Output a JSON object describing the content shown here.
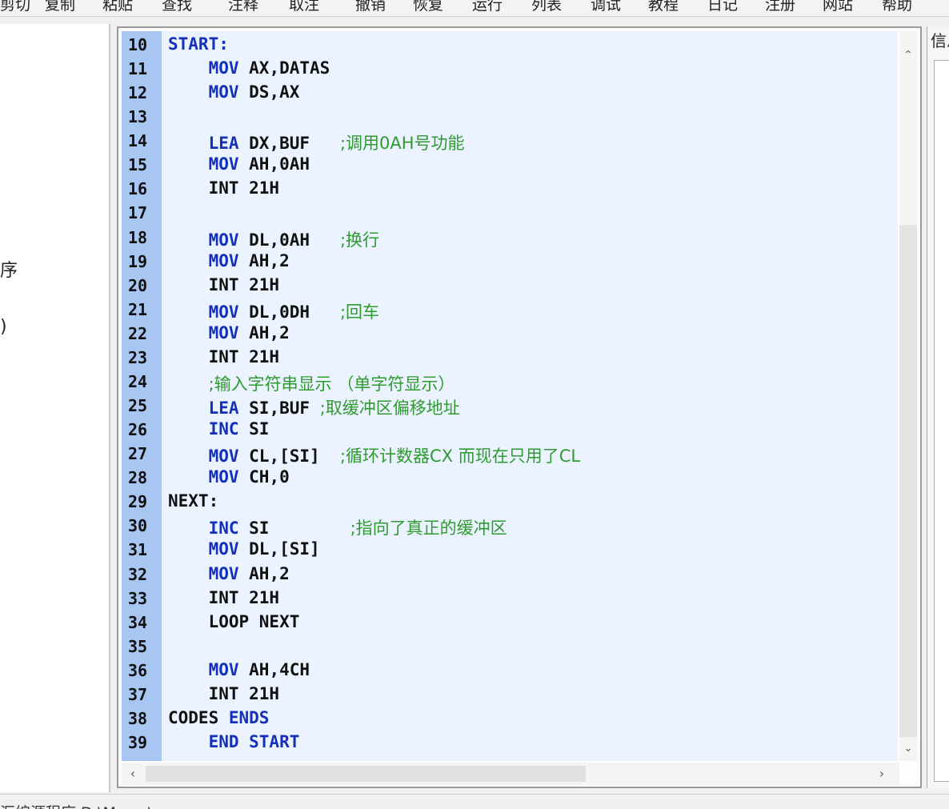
{
  "toolbar": {
    "items": [
      "剪切",
      "复制",
      "粘贴",
      "查找",
      "注释",
      "取注",
      "撤销",
      "恢复",
      "运行",
      "列表",
      "调试",
      "教程",
      "日记",
      "注册",
      "网站",
      "帮助"
    ]
  },
  "left_panel": {
    "frag1": "序",
    "frag2": ")"
  },
  "right_panel": {
    "title": "信息"
  },
  "editor": {
    "lines": [
      {
        "n": "10",
        "segs": [
          {
            "t": "START:",
            "c": "kw"
          }
        ]
      },
      {
        "n": "11",
        "segs": [
          {
            "t": "    "
          },
          {
            "t": "MOV",
            "c": "kw"
          },
          {
            "t": " AX,DATAS"
          }
        ]
      },
      {
        "n": "12",
        "segs": [
          {
            "t": "    "
          },
          {
            "t": "MOV",
            "c": "kw"
          },
          {
            "t": " DS,AX"
          }
        ]
      },
      {
        "n": "13",
        "segs": []
      },
      {
        "n": "14",
        "segs": [
          {
            "t": "    "
          },
          {
            "t": "LEA",
            "c": "kw"
          },
          {
            "t": " DX,BUF   "
          },
          {
            "t": ";调用0AH号功能",
            "c": "cm"
          }
        ]
      },
      {
        "n": "15",
        "segs": [
          {
            "t": "    "
          },
          {
            "t": "MOV",
            "c": "kw"
          },
          {
            "t": " AH,0AH"
          }
        ]
      },
      {
        "n": "16",
        "segs": [
          {
            "t": "    INT 21H"
          }
        ]
      },
      {
        "n": "17",
        "segs": []
      },
      {
        "n": "18",
        "segs": [
          {
            "t": "    "
          },
          {
            "t": "MOV",
            "c": "kw"
          },
          {
            "t": " DL,0AH   "
          },
          {
            "t": ";换行",
            "c": "cm"
          }
        ]
      },
      {
        "n": "19",
        "segs": [
          {
            "t": "    "
          },
          {
            "t": "MOV",
            "c": "kw"
          },
          {
            "t": " AH,2"
          }
        ]
      },
      {
        "n": "20",
        "segs": [
          {
            "t": "    INT 21H"
          }
        ]
      },
      {
        "n": "21",
        "segs": [
          {
            "t": "    "
          },
          {
            "t": "MOV",
            "c": "kw"
          },
          {
            "t": " DL,0DH   "
          },
          {
            "t": ";回车",
            "c": "cm"
          }
        ]
      },
      {
        "n": "22",
        "segs": [
          {
            "t": "    "
          },
          {
            "t": "MOV",
            "c": "kw"
          },
          {
            "t": " AH,2"
          }
        ]
      },
      {
        "n": "23",
        "segs": [
          {
            "t": "    INT 21H"
          }
        ]
      },
      {
        "n": "24",
        "segs": [
          {
            "t": "    "
          },
          {
            "t": ";输入字符串显示 （单字符显示）",
            "c": "cm"
          }
        ]
      },
      {
        "n": "25",
        "segs": [
          {
            "t": "    "
          },
          {
            "t": "LEA",
            "c": "kw"
          },
          {
            "t": " SI,BUF "
          },
          {
            "t": ";取缓冲区偏移地址",
            "c": "cm"
          }
        ]
      },
      {
        "n": "26",
        "segs": [
          {
            "t": "    "
          },
          {
            "t": "INC",
            "c": "kw"
          },
          {
            "t": " SI"
          }
        ]
      },
      {
        "n": "27",
        "segs": [
          {
            "t": "    "
          },
          {
            "t": "MOV",
            "c": "kw"
          },
          {
            "t": " CL,[SI]  "
          },
          {
            "t": ";循环计数器CX 而现在只用了CL",
            "c": "cm"
          }
        ]
      },
      {
        "n": "28",
        "segs": [
          {
            "t": "    "
          },
          {
            "t": "MOV",
            "c": "kw"
          },
          {
            "t": " CH,0"
          }
        ]
      },
      {
        "n": "29",
        "segs": [
          {
            "t": "NEXT:"
          }
        ]
      },
      {
        "n": "30",
        "segs": [
          {
            "t": "    "
          },
          {
            "t": "INC",
            "c": "kw"
          },
          {
            "t": " SI        "
          },
          {
            "t": ";指向了真正的缓冲区",
            "c": "cm"
          }
        ]
      },
      {
        "n": "31",
        "segs": [
          {
            "t": "    "
          },
          {
            "t": "MOV",
            "c": "kw"
          },
          {
            "t": " DL,[SI]"
          }
        ]
      },
      {
        "n": "32",
        "segs": [
          {
            "t": "    "
          },
          {
            "t": "MOV",
            "c": "kw"
          },
          {
            "t": " AH,2"
          }
        ]
      },
      {
        "n": "33",
        "segs": [
          {
            "t": "    INT 21H"
          }
        ]
      },
      {
        "n": "34",
        "segs": [
          {
            "t": "    LOOP NEXT"
          }
        ]
      },
      {
        "n": "35",
        "segs": []
      },
      {
        "n": "36",
        "segs": [
          {
            "t": "    "
          },
          {
            "t": "MOV",
            "c": "kw"
          },
          {
            "t": " AH,4CH"
          }
        ]
      },
      {
        "n": "37",
        "segs": [
          {
            "t": "    INT 21H"
          }
        ]
      },
      {
        "n": "38",
        "segs": [
          {
            "t": "CODES "
          },
          {
            "t": "ENDS",
            "c": "kw"
          }
        ]
      },
      {
        "n": "39",
        "segs": [
          {
            "t": "    "
          },
          {
            "t": "END START",
            "c": "kw"
          }
        ]
      }
    ]
  },
  "status": {
    "text": "汇编源程序 D:\\Masm\\..."
  },
  "icons": {
    "scroll_up": "chevron-up-icon",
    "scroll_down": "chevron-down-icon",
    "scroll_left": "chevron-left-icon",
    "scroll_right": "chevron-right-icon"
  }
}
